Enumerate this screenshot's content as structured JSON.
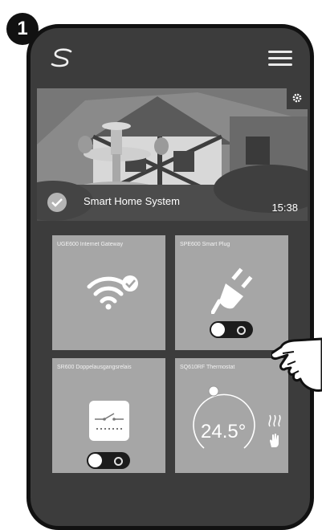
{
  "step_badge": "1",
  "header": {
    "logo_icon": "salus-s-logo-icon",
    "menu_icon": "hamburger-menu-icon"
  },
  "hero": {
    "title": "Smart Home System",
    "time": "15:38",
    "settings_icon": "gear-icon",
    "status_icon": "check-circle-icon"
  },
  "tiles": [
    {
      "label": "UGE600 Internet Gateway",
      "icon": "wifi-check-icon"
    },
    {
      "label": "SPE600 Smart Plug",
      "icon": "plug-icon",
      "toggle_on": true
    },
    {
      "label": "SR600 Doppelausgangsrelais",
      "icon": "relay-switch-icon",
      "toggle_on": true
    },
    {
      "label": "SQ610RF Thermostat",
      "icon": "thermostat-dial-icon",
      "temperature": "24.5°",
      "side_icons": [
        "heat-waves-icon",
        "hand-icon"
      ]
    }
  ],
  "colors": {
    "frame": "#111111",
    "screen": "#3c3c3c",
    "tile": "#a6a6a6",
    "text": "#ffffff"
  }
}
